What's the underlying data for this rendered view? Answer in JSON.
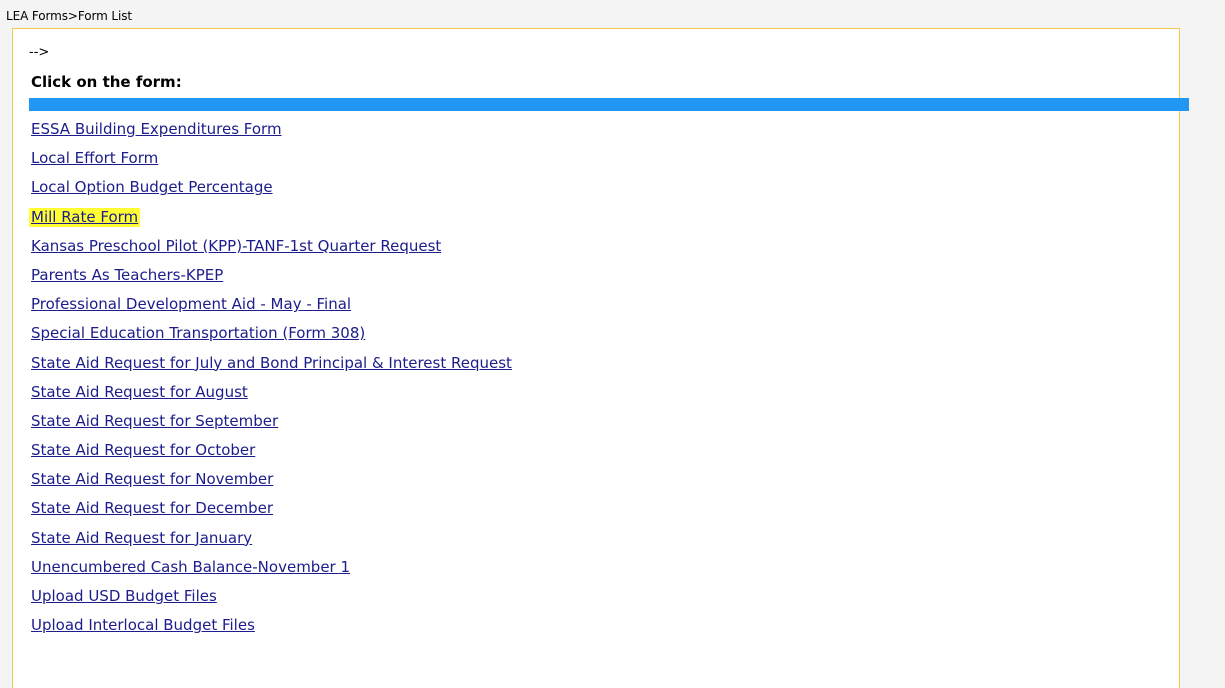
{
  "breadcrumb": "LEA Forms>Form List",
  "comment_text": "-->",
  "heading": "Click on the form:",
  "colors": {
    "accent_bar": "#2196f3",
    "highlight": "#ffff33",
    "link": "#1c1c8c",
    "panel_border": "#f2c94c"
  },
  "forms": [
    {
      "label": "ESSA Building Expenditures Form",
      "highlighted": false
    },
    {
      "label": "Local Effort Form",
      "highlighted": false
    },
    {
      "label": "Local Option Budget Percentage",
      "highlighted": false
    },
    {
      "label": "Mill Rate Form",
      "highlighted": true
    },
    {
      "label": "Kansas Preschool Pilot (KPP)-TANF-1st Quarter Request",
      "highlighted": false
    },
    {
      "label": "Parents As Teachers-KPEP",
      "highlighted": false
    },
    {
      "label": "Professional Development Aid - May - Final",
      "highlighted": false
    },
    {
      "label": "Special Education Transportation (Form 308)",
      "highlighted": false
    },
    {
      "label": "State Aid Request for July and Bond Principal & Interest Request",
      "highlighted": false
    },
    {
      "label": "State Aid Request for August",
      "highlighted": false
    },
    {
      "label": "State Aid Request for September",
      "highlighted": false
    },
    {
      "label": "State Aid Request for October",
      "highlighted": false
    },
    {
      "label": "State Aid Request for November",
      "highlighted": false
    },
    {
      "label": "State Aid Request for December",
      "highlighted": false
    },
    {
      "label": "State Aid Request for January",
      "highlighted": false
    },
    {
      "label": "Unencumbered Cash Balance-November 1",
      "highlighted": false
    },
    {
      "label": "Upload USD Budget Files",
      "highlighted": false
    },
    {
      "label": "Upload Interlocal Budget Files",
      "highlighted": false
    }
  ]
}
